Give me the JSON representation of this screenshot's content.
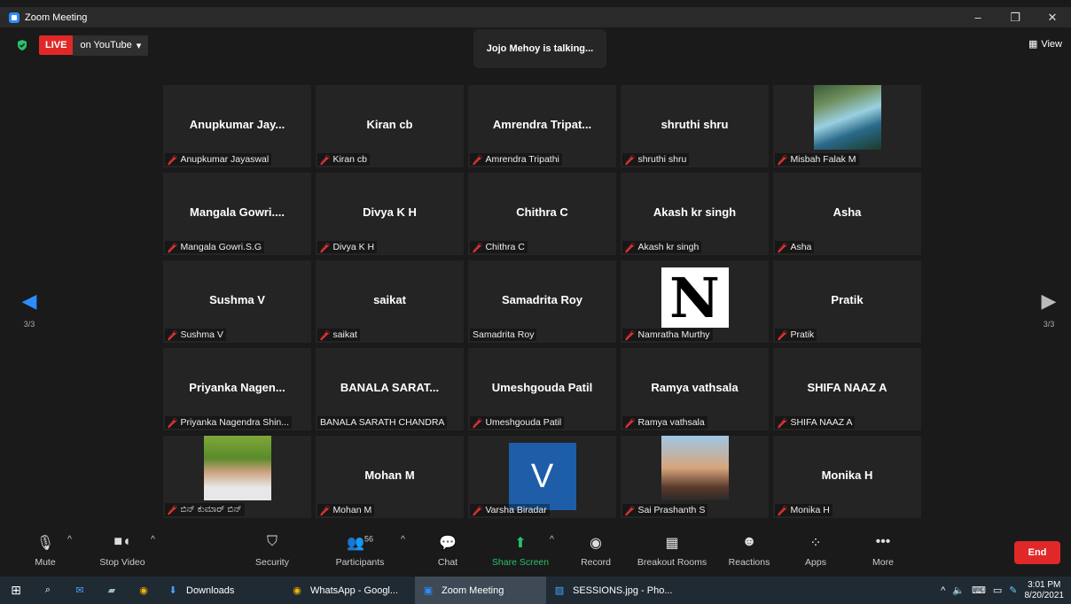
{
  "window": {
    "title": "Zoom Meeting",
    "controls": [
      "–",
      "❐",
      "✕"
    ]
  },
  "status": {
    "live": "LIVE",
    "stream_target": "on YouTube",
    "talking": "Jojo Mehoy is talking...",
    "view_label": "View"
  },
  "pager": {
    "left": "3/3",
    "right": "3/3"
  },
  "participants": [
    {
      "display": "Anupkumar  Jay...",
      "label": "Anupkumar Jayaswal",
      "muted": true
    },
    {
      "display": "Kiran cb",
      "label": "Kiran cb",
      "muted": true
    },
    {
      "display": "Amrendra  Tripat...",
      "label": "Amrendra Tripathi",
      "muted": true
    },
    {
      "display": "shruthi shru",
      "label": "shruthi shru",
      "muted": true
    },
    {
      "display": "",
      "label": "Misbah Falak M",
      "muted": true,
      "photo": "misbah"
    },
    {
      "display": "Mangala  Gowri....",
      "label": "Mangala Gowri.S.G",
      "muted": true
    },
    {
      "display": "Divya K H",
      "label": "Divya K H",
      "muted": true
    },
    {
      "display": "Chithra C",
      "label": "Chithra C",
      "muted": true
    },
    {
      "display": "Akash kr singh",
      "label": "Akash kr singh",
      "muted": true
    },
    {
      "display": "Asha",
      "label": "Asha",
      "muted": true
    },
    {
      "display": "Sushma V",
      "label": "Sushma V",
      "muted": true
    },
    {
      "display": "saikat",
      "label": "saikat",
      "muted": true
    },
    {
      "display": "Samadrita Roy",
      "label": "Samadrita Roy",
      "muted": false
    },
    {
      "display": "",
      "label": "Namratha Murthy",
      "muted": true,
      "photo": "n",
      "photo_text": "N"
    },
    {
      "display": "Pratik",
      "label": "Pratik",
      "muted": true
    },
    {
      "display": "Priyanka  Nagen...",
      "label": "Priyanka Nagendra Shin...",
      "muted": true
    },
    {
      "display": "BANALA  SARAT...",
      "label": "BANALA SARATH CHANDRA",
      "muted": false
    },
    {
      "display": "Umeshgouda Patil",
      "label": "Umeshgouda Patil",
      "muted": true
    },
    {
      "display": "Ramya vathsala",
      "label": "Ramya vathsala",
      "muted": true
    },
    {
      "display": "SHIFA NAAZ A",
      "label": "SHIFA NAAZ A",
      "muted": true
    },
    {
      "display": "",
      "label": "ಬಿನ್ ಕುಮಾರ್ ಬಿನ್",
      "muted": true,
      "photo": "binkumar"
    },
    {
      "display": "Mohan M",
      "label": "Mohan M",
      "muted": true
    },
    {
      "display": "",
      "label": "Varsha Biradar",
      "muted": true,
      "photo": "v",
      "photo_text": "V"
    },
    {
      "display": "",
      "label": "Sai Prashanth S",
      "muted": true,
      "photo": "sai"
    },
    {
      "display": "Monika H",
      "label": "Monika H",
      "muted": true
    }
  ],
  "toolbar": {
    "mute": "Mute",
    "stop_video": "Stop Video",
    "security": "Security",
    "participants": "Participants",
    "participants_count": "56",
    "chat": "Chat",
    "share_screen": "Share Screen",
    "record": "Record",
    "breakout_rooms": "Breakout Rooms",
    "reactions": "Reactions",
    "apps": "Apps",
    "more": "More",
    "end": "End"
  },
  "taskbar": {
    "downloads": "Downloads",
    "whatsapp": "WhatsApp - Googl...",
    "zoom": "Zoom Meeting",
    "photos": "SESSIONS.jpg - Pho...",
    "time": "3:01 PM",
    "date": "8/20/2021"
  },
  "colors": {
    "live": "#e02828",
    "accent": "#2d8cff",
    "share": "#27c26b",
    "mute": "#e33333"
  }
}
